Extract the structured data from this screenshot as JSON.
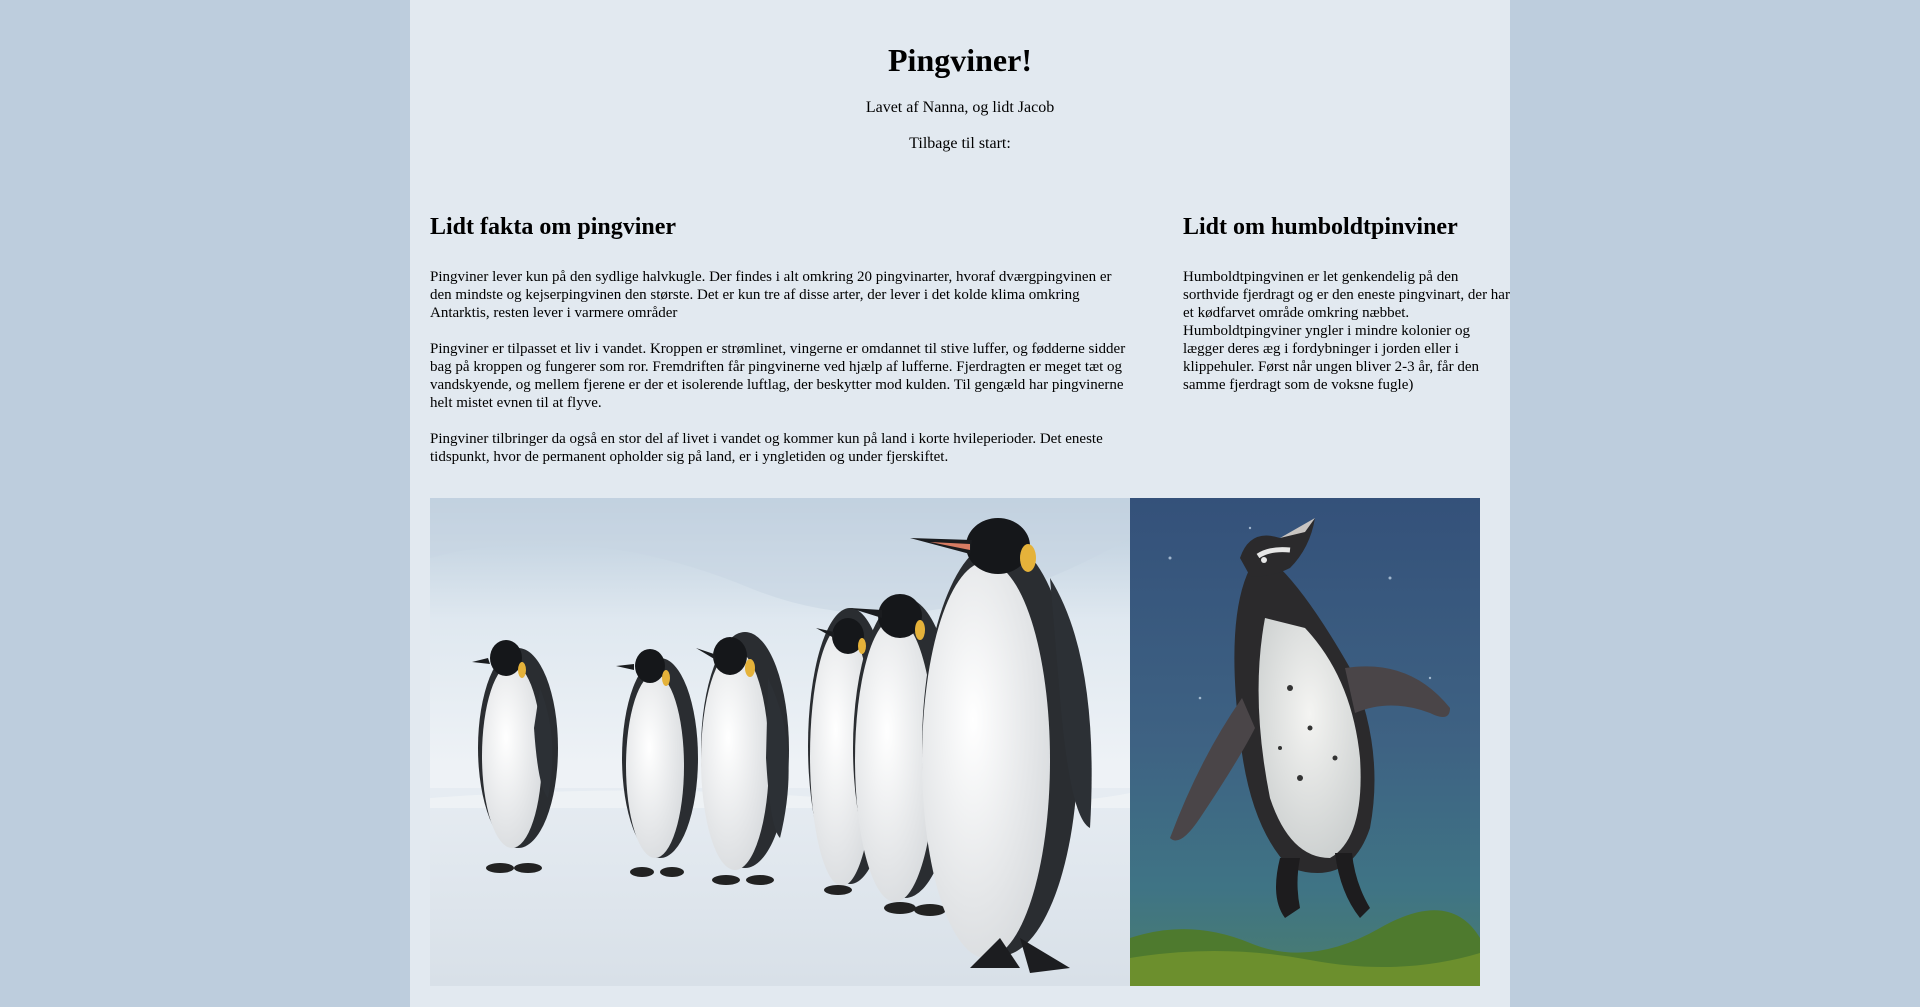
{
  "header": {
    "title": "Pingviner!",
    "byline": "Lavet af Nanna, og lidt Jacob",
    "back_label": "Tilbage til start:"
  },
  "facts": {
    "heading": "Lidt fakta om pingviner",
    "paragraphs": [
      "Pingviner lever kun på den sydlige halvkugle. Der findes i alt omkring 20 pingvinarter, hvoraf dværgpingvinen er den mindste og kejserpingvinen den største. Det er kun tre af disse arter, der lever i det kolde klima omkring Antarktis, resten lever i varmere områder",
      "Pingviner er tilpasset et liv i vandet. Kroppen er strømlinet, vingerne er omdannet til stive luffer, og fødderne sidder bag på kroppen og fungerer som ror. Fremdriften får pingvinerne ved hjælp af lufferne. Fjerdragten er meget tæt og vandskyende, og mellem fjerene er der et isolerende luftlag, der beskytter mod kulden. Til gengæld har pingvinerne helt mistet evnen til at flyve.",
      "Pingviner tilbringer da også en stor del af livet i vandet og kommer kun på land i korte hvileperioder. Det eneste tidspunkt, hvor de permanent opholder sig på land, er i yngletiden og under fjerskiftet."
    ]
  },
  "humboldt": {
    "heading": "Lidt om humboldtpinviner",
    "paragraph": "Humboldtpingvinen er let genkendelig på den sorthvide fjerdragt og er den eneste pingvinart, der har et kødfarvet område omkring næbbet. Humboldtpingviner yngler i mindre kolonier og lægger deres æg i fordybninger i jorden eller i klippehuler. Først når ungen bliver 2-3 år, får den samme fjerdragt som de voksne fugle)"
  },
  "images": {
    "emperor": "emperor-penguins-photo",
    "humboldt": "humboldt-penguin-photo"
  },
  "colors": {
    "outer_background": "#bdcddd",
    "page_background": "#e2e9f0"
  }
}
